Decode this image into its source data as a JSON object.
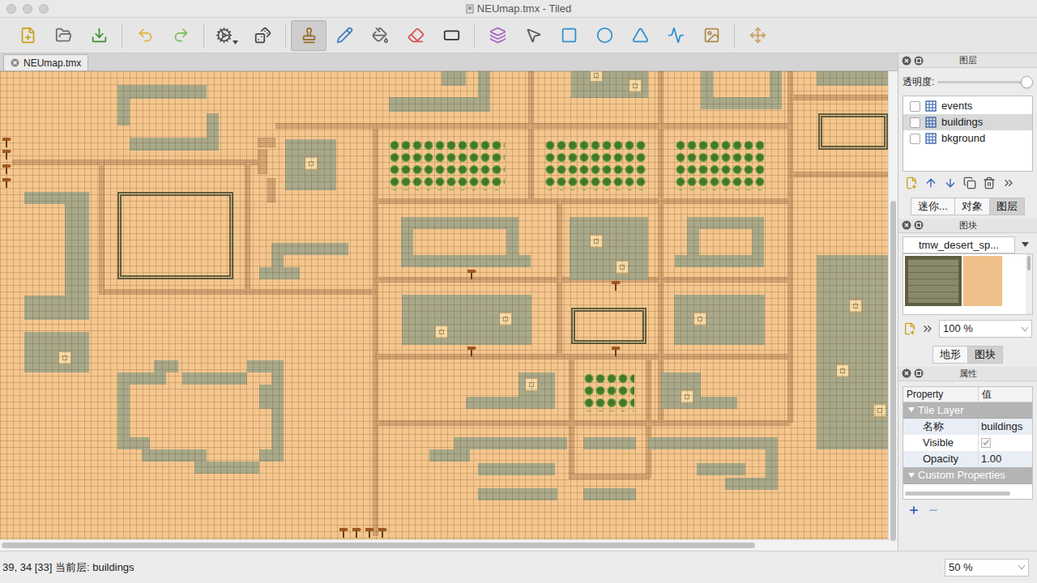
{
  "window": {
    "title": "NEUmap.tmx - Tiled"
  },
  "toolbar": {
    "tools": [
      {
        "kind": "new",
        "selected": false
      },
      {
        "kind": "open",
        "selected": false
      },
      {
        "kind": "save",
        "selected": false
      },
      {
        "kind": "undo",
        "selected": false
      },
      {
        "kind": "redo",
        "selected": false
      },
      {
        "kind": "command",
        "selected": false
      },
      {
        "kind": "random",
        "selected": false
      },
      {
        "kind": "stamp",
        "selected": true
      },
      {
        "kind": "terrain",
        "selected": false
      },
      {
        "kind": "fill",
        "selected": false
      },
      {
        "kind": "eraser",
        "selected": false
      },
      {
        "kind": "select",
        "selected": false
      },
      {
        "kind": "objects",
        "selected": false
      },
      {
        "kind": "edit",
        "selected": false
      },
      {
        "kind": "rect",
        "selected": false
      },
      {
        "kind": "ellipse",
        "selected": false
      },
      {
        "kind": "polygon",
        "selected": false
      },
      {
        "kind": "polyline",
        "selected": false
      },
      {
        "kind": "tile",
        "selected": false
      },
      {
        "kind": "move",
        "selected": false
      }
    ]
  },
  "document_tabs": [
    {
      "label": "NEUmap.tmx",
      "selected": true
    }
  ],
  "layers_panel": {
    "title": "图层",
    "opacity_label": "透明度:",
    "opacity": {
      "level": 1.0
    },
    "layers": [
      {
        "name": "events",
        "visible": false,
        "selected": false
      },
      {
        "name": "buildings",
        "visible": false,
        "selected": true
      },
      {
        "name": "bkground",
        "visible": false,
        "selected": false
      }
    ],
    "tabs": [
      {
        "label": "迷你...",
        "selected": false
      },
      {
        "label": "对象",
        "selected": false
      },
      {
        "label": "图层",
        "selected": true
      }
    ]
  },
  "tileset_panel": {
    "title": "图块",
    "tileset": "tmw_desert_sp...",
    "zoom": "100 %",
    "tabs": [
      {
        "label": "地形",
        "selected": false
      },
      {
        "label": "图块",
        "selected": true
      }
    ]
  },
  "properties_panel": {
    "title": "属性",
    "columns": [
      "Property",
      "值"
    ],
    "groups": [
      {
        "label": "Tile Layer",
        "expanded": true,
        "rows": [
          {
            "name": "名称",
            "kind": "text",
            "value": "buildings"
          },
          {
            "name": "Visible",
            "kind": "checkbox",
            "checked": true
          },
          {
            "name": "Opacity",
            "kind": "text",
            "value": "1.00"
          }
        ]
      },
      {
        "label": "Custom Properties",
        "expanded": true,
        "rows": []
      }
    ]
  },
  "status_bar": {
    "position": "39, 34 [33] 当前层: buildings",
    "zoom": "50 %"
  }
}
